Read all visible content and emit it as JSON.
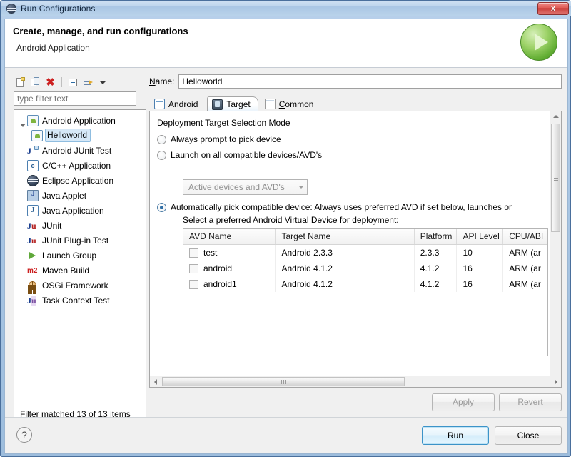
{
  "window": {
    "title": "Run Configurations",
    "title_icon": "eclipse-icon",
    "close_label": "x"
  },
  "header": {
    "title": "Create, manage, and run configurations",
    "subtitle": "Android Application",
    "icon": "green-run-icon"
  },
  "sidebar": {
    "toolbar": [
      {
        "name": "new-launch-configuration-icon",
        "label": ""
      },
      {
        "name": "duplicate-icon",
        "label": ""
      },
      {
        "name": "delete-icon",
        "label": "✖"
      },
      {
        "name": "collapse-all-icon",
        "label": ""
      },
      {
        "name": "filter-icon",
        "label": ""
      },
      {
        "name": "view-menu-chevron-icon",
        "label": ""
      }
    ],
    "filter": {
      "placeholder": "type filter text",
      "value": ""
    },
    "tree": [
      {
        "label": "Android Application",
        "icon": "android-icon",
        "level": 0,
        "expanded": true,
        "selected": false
      },
      {
        "label": "Helloworld",
        "icon": "android-icon",
        "level": 1,
        "expanded": false,
        "selected": true
      },
      {
        "label": "Android JUnit Test",
        "icon": "android-junit-icon",
        "level": 0,
        "expanded": false,
        "selected": false
      },
      {
        "label": "C/C++ Application",
        "icon": "cpp-icon",
        "level": 0,
        "expanded": false,
        "selected": false
      },
      {
        "label": "Eclipse Application",
        "icon": "eclipse-icon",
        "level": 0,
        "expanded": false,
        "selected": false
      },
      {
        "label": "Java Applet",
        "icon": "java-applet-icon",
        "level": 0,
        "expanded": false,
        "selected": false
      },
      {
        "label": "Java Application",
        "icon": "java-application-icon",
        "level": 0,
        "expanded": false,
        "selected": false
      },
      {
        "label": "JUnit",
        "icon": "junit-icon",
        "level": 0,
        "expanded": false,
        "selected": false
      },
      {
        "label": "JUnit Plug-in Test",
        "icon": "junit-plugin-icon",
        "level": 0,
        "expanded": false,
        "selected": false
      },
      {
        "label": "Launch Group",
        "icon": "launch-group-icon",
        "level": 0,
        "expanded": false,
        "selected": false
      },
      {
        "label": "Maven Build",
        "icon": "maven-icon",
        "level": 0,
        "expanded": false,
        "selected": false
      },
      {
        "label": "OSGi Framework",
        "icon": "osgi-icon",
        "level": 0,
        "expanded": false,
        "selected": false
      },
      {
        "label": "Task Context Test",
        "icon": "task-context-icon",
        "level": 0,
        "expanded": false,
        "selected": false
      }
    ],
    "status": "Filter matched 13 of 13 items"
  },
  "main": {
    "name_label": "Name:",
    "name_value": "Helloworld",
    "tabs": [
      {
        "label": "Android",
        "icon": "android-tab-icon",
        "active": false
      },
      {
        "label": "Target",
        "icon": "target-tab-icon",
        "active": true
      },
      {
        "label": "Common",
        "icon": "common-tab-icon",
        "active": false
      }
    ],
    "target": {
      "section_title": "Deployment Target Selection Mode",
      "options": [
        {
          "label": "Always prompt to pick device",
          "selected": false
        },
        {
          "label": "Launch on all compatible devices/AVD's",
          "selected": false
        },
        {
          "label": "Automatically pick compatible device: Always uses preferred AVD if set below, launches or",
          "selected": true
        }
      ],
      "device_combo": {
        "value": "Active devices and AVD's",
        "arrow": "chevron-down-icon"
      },
      "avd_prompt": "Select a preferred Android Virtual Device for deployment:",
      "table": {
        "columns": [
          "AVD Name",
          "Target Name",
          "Platform",
          "API Level",
          "CPU/ABI"
        ],
        "rows": [
          {
            "checked": false,
            "avd_name": "test",
            "target_name": "Android 2.3.3",
            "platform": "2.3.3",
            "api_level": "10",
            "cpu_abi": "ARM (ar"
          },
          {
            "checked": false,
            "avd_name": "android",
            "target_name": "Android 4.1.2",
            "platform": "4.1.2",
            "api_level": "16",
            "cpu_abi": "ARM (ar"
          },
          {
            "checked": false,
            "avd_name": "android1",
            "target_name": "Android 4.1.2",
            "platform": "4.1.2",
            "api_level": "16",
            "cpu_abi": "ARM (ar"
          }
        ]
      }
    },
    "apply_label": "Apply",
    "revert_label": "Revert"
  },
  "footer": {
    "help_label": "?",
    "run_label": "Run",
    "close_label": "Close"
  },
  "colors": {
    "accent": "#2f6ea5",
    "title_bar": "#b8d0ea",
    "run_green": "#62ae33",
    "close_red": "#c93c38"
  }
}
